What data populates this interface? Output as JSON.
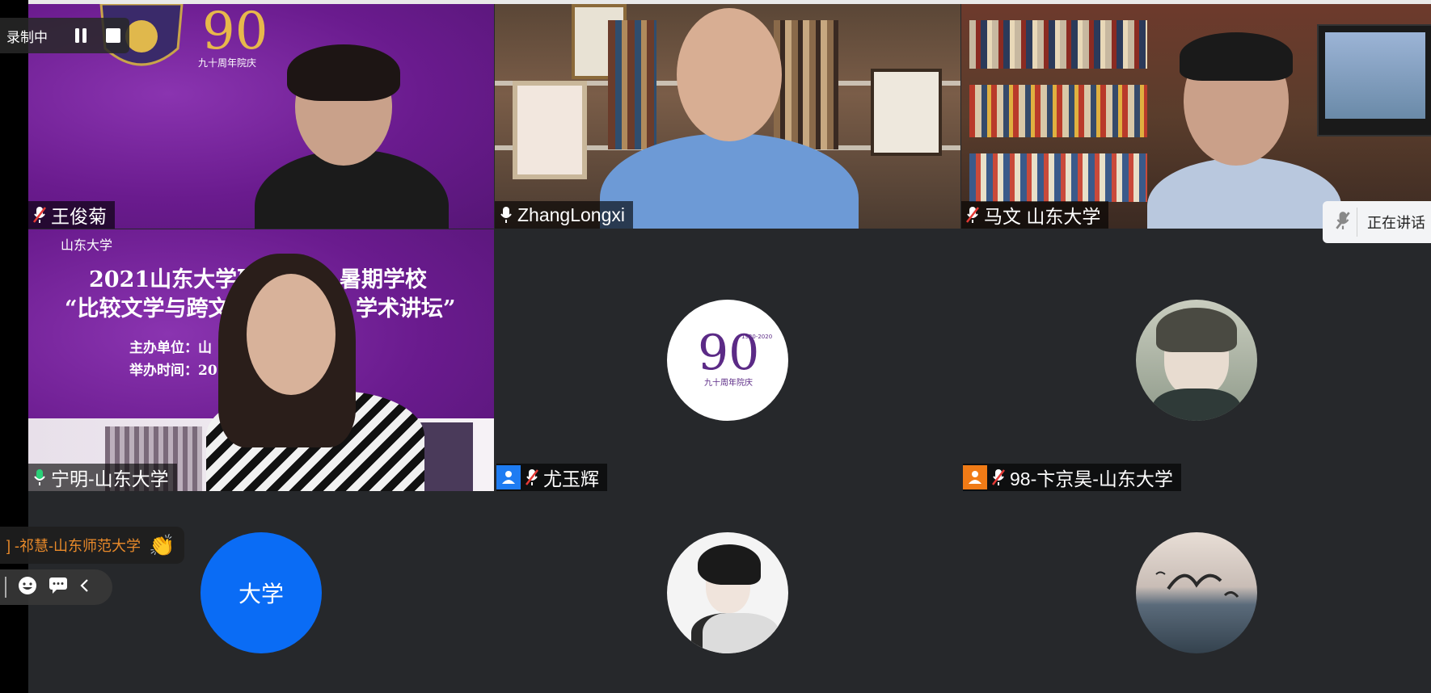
{
  "recording": {
    "label": "录制中"
  },
  "participants": [
    {
      "name": "王俊菊",
      "mic": "muted"
    },
    {
      "name": "ZhangLongxi",
      "mic": "on"
    },
    {
      "name": "马文 山东大学",
      "mic": "muted"
    },
    {
      "name": "宁明-山东大学",
      "mic": "active",
      "poster_line1": "2021山东大学研",
      "poster_line1b": "暑期学校",
      "poster_line2": "“比较文学与跨文",
      "poster_line2b": "学术讲坛”",
      "poster_line3": "主办单位：山",
      "poster_line4": "举办时间：20",
      "poster_brand": "山东大学"
    },
    {
      "name": "尤玉辉",
      "mic": "muted",
      "avatar": "logo"
    },
    {
      "name": "98-卞京昊-山东大学",
      "mic": "muted",
      "avatar": "anime"
    },
    {
      "name": "",
      "avatar_text": "大学"
    },
    {
      "name": "",
      "avatar": "portrait"
    },
    {
      "name": "",
      "avatar": "seagull"
    }
  ],
  "reaction": {
    "text": "] -祁慧-山东师范大学",
    "emoji": "👏"
  },
  "speaking": {
    "label": "正在讲话"
  },
  "logo": {
    "years": "1930-2020",
    "caption": "九十周年院庆",
    "number": "90"
  },
  "colors": {
    "active_border": "#2ad178",
    "avatar_blue": "#0a6cf5",
    "user_badge_blue": "#1e7cf2",
    "user_badge_orange": "#f07b16",
    "purple": "#6a1b8e"
  }
}
